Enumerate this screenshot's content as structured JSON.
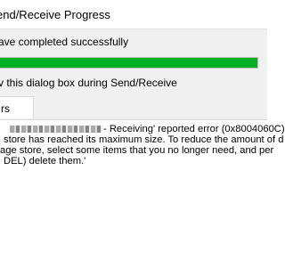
{
  "window": {
    "title": "end/Receive Progress"
  },
  "progress": {
    "status_text": "ave completed successfully",
    "fraction": 1.0,
    "fill_color": "#06b025"
  },
  "options": {
    "show_dialog_label": "v this dialog box during Send/Receive"
  },
  "tabs": [
    {
      "label": "rs"
    }
  ],
  "errors": {
    "line1": "- Receiving' reported error (0x8004060C)",
    "line2": "store has reached its maximum size. To reduce the amount of d",
    "line3": "age store, select some items that you no longer need, and per",
    "line4": "DEL) delete them.'"
  }
}
